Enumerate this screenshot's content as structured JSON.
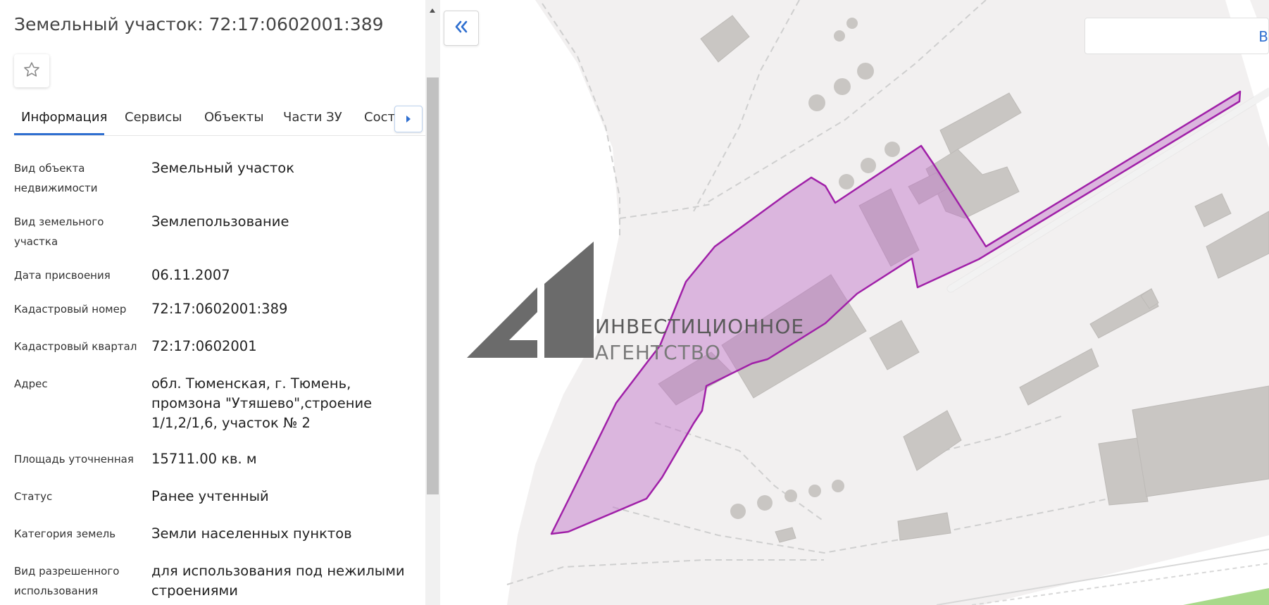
{
  "panel": {
    "title": "Земельный участок: 72:17:0602001:389",
    "favorite_icon": "star-outline-icon",
    "tabs": [
      {
        "label": "Информация",
        "active": true
      },
      {
        "label": "Сервисы",
        "active": false
      },
      {
        "label": "Объекты",
        "active": false
      },
      {
        "label": "Части ЗУ",
        "active": false
      },
      {
        "label": "Состав",
        "active": false
      }
    ],
    "tab_scroll_icon": "triangle-right-icon",
    "fields": [
      {
        "label": "Вид объекта недвижимости",
        "value": "Земельный участок"
      },
      {
        "label": "Вид земельного участка",
        "value": "Землепользование"
      },
      {
        "label": "Дата присвоения",
        "value": "06.11.2007"
      },
      {
        "label": "Кадастровый номер",
        "value": "72:17:0602001:389"
      },
      {
        "label": "Кадастровый квартал",
        "value": "72:17:0602001"
      },
      {
        "label": "Адрес",
        "value": "обл. Тюменская, г. Тюмень, промзона \"Утяшево\",строение 1/1,2/1,6, участок № 2"
      },
      {
        "label": "Площадь уточненная",
        "value": "15711.00 кв. м"
      },
      {
        "label": "Статус",
        "value": "Ранее учтенный"
      },
      {
        "label": "Категория земель",
        "value": "Земли населенных пунктов"
      },
      {
        "label": "Вид разрешенного использования",
        "value": "для использования под нежилыми строениями"
      }
    ]
  },
  "map": {
    "collapse_icon": "double-chevron-left-icon",
    "search_label": "В",
    "watermark_line1": "ИНВЕСТИЦИОННОЕ",
    "watermark_line2": "АГЕНТСТВО",
    "parcel_color": "#a020a8",
    "accent": "#2f6fd0"
  }
}
